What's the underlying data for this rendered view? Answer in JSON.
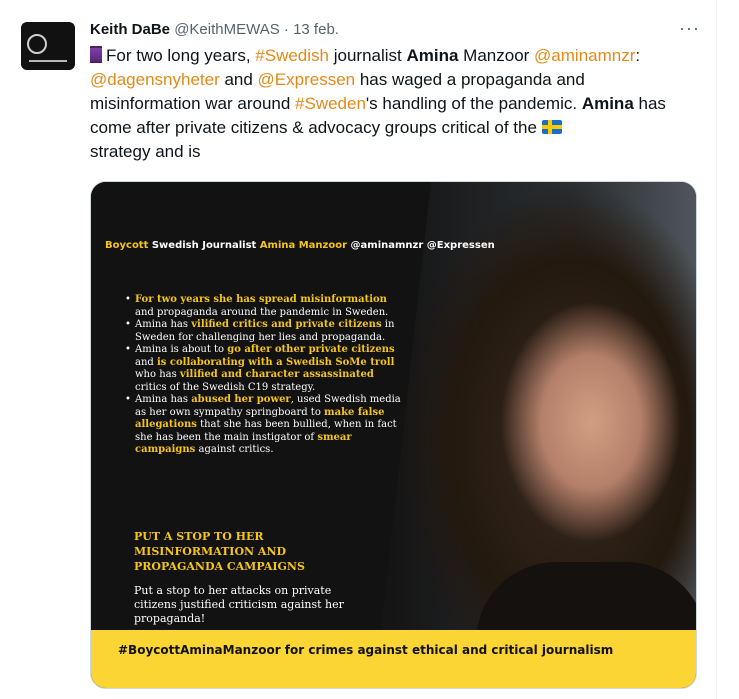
{
  "tweet": {
    "author_name": "Keith DaBe",
    "author_handle": "@KeithMEWAS",
    "separator": "·",
    "date": "13 feb.",
    "more_glyph": "···",
    "text": {
      "p1": "For two long years, ",
      "h1": "#Swedish",
      "p2": " journalist ",
      "b1": "Amina",
      "p3": " Manzoor ",
      "m1": "@aminamnzr",
      "p4": ":",
      "m2": "@dagensnyheter",
      "p5": " and ",
      "m3": "@Expressen",
      "p6": " has waged a propaganda and misinformation war around ",
      "h2": "#Sweden",
      "p7": "'s handling of the pandemic. ",
      "b2": "Amina",
      "p8": " has come after private citizens & advocacy groups critical of the ",
      "p9": " strategy and is"
    },
    "icons": {
      "thread": "spool-icon",
      "flag": "sweden-flag-icon"
    }
  },
  "media": {
    "title": {
      "boycott": "Boycott",
      "rest_a": "  Swedish Journalist ",
      "name": "Amina Manzoor",
      "rest_b": " @aminamnzr @Expressen"
    },
    "bullets": [
      {
        "a": "For two years she has  spread misinformation",
        "b": " and propaganda around the pandemic in Sweden."
      },
      {
        "pre": "Amina has ",
        "hl": "vilified critics and private citizens",
        "post": " in Sweden for challenging her lies and propaganda."
      },
      {
        "pre": "Amina is about to ",
        "hl1": "go after other private citizens",
        "mid": " and ",
        "hl2": "is collaborating with a Swedish SoMe troll",
        "mid2": " who has ",
        "hl3": "vilified and character assassinated",
        "post": " critics of the Swedish C19 strategy."
      },
      {
        "pre": "Amina has ",
        "hl1": "abused her power",
        "mid": ", used Swedish media as her own sympathy springboard to ",
        "hl2": "make false allegations",
        "mid2": " that she has been bullied, when in fact she has been the main instigator of ",
        "hl3": "smear campaigns",
        "post": " against critics."
      }
    ],
    "call_heading": "PUT A STOP TO HER\nMISINFORMATION AND\nPROPAGANDA CAMPAIGNS",
    "call_body": "Put a stop to her attacks on private citizens justified criticism against her propaganda!",
    "banner": "#BoycottAminaManzoor for crimes against ethical and critical journalism"
  },
  "colors": {
    "link": "#e28a18",
    "highlight": "#f5c518",
    "banner": "#fbd534"
  }
}
